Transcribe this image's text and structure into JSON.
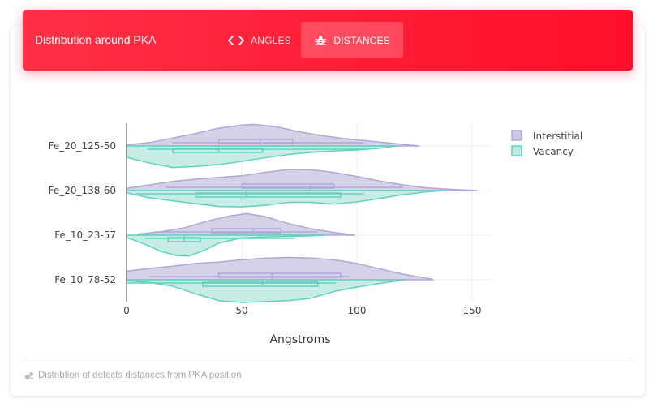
{
  "header": {
    "title": "Distribution around PKA",
    "tabs": [
      {
        "label": "ANGLES",
        "icon": "code-icon",
        "active": false
      },
      {
        "label": "DISTANCES",
        "icon": "bug-icon",
        "active": true
      }
    ],
    "accent": "#ff1a35"
  },
  "chart_data": {
    "type": "violin",
    "orientation": "horizontal",
    "categories": [
      "Fe_10_78-52",
      "Fe_10_23-57",
      "Fe_20_138-60",
      "Fe_20_125-50"
    ],
    "xlabel": "Angstroms",
    "xlim": [
      0,
      160
    ],
    "xticks": [
      0,
      50,
      100,
      150
    ],
    "grid": true,
    "legend": "top-right",
    "series": [
      {
        "name": "Interstitial",
        "side": "positive",
        "fill": "#cfc8e4",
        "stroke": "#b1a7d7",
        "violins": [
          {
            "category": "Fe_10_78-52",
            "min": 0,
            "max": 133,
            "q1": 40,
            "median": 63,
            "q3": 93,
            "whisker_low": 10,
            "whisker_high": 97,
            "density": [
              [
                0,
                0.38
              ],
              [
                10,
                0.5
              ],
              [
                20,
                0.6
              ],
              [
                30,
                0.72
              ],
              [
                40,
                0.78
              ],
              [
                50,
                0.88
              ],
              [
                60,
                0.95
              ],
              [
                70,
                0.98
              ],
              [
                80,
                0.96
              ],
              [
                90,
                0.88
              ],
              [
                100,
                0.72
              ],
              [
                110,
                0.48
              ],
              [
                120,
                0.25
              ],
              [
                133,
                0.02
              ]
            ]
          },
          {
            "category": "Fe_10_23-57",
            "min": 5,
            "max": 99,
            "q1": 37,
            "median": 55,
            "q3": 67,
            "whisker_low": 12,
            "whisker_high": 83,
            "density": [
              [
                5,
                0.05
              ],
              [
                15,
                0.15
              ],
              [
                25,
                0.32
              ],
              [
                35,
                0.62
              ],
              [
                45,
                0.85
              ],
              [
                52,
                0.95
              ],
              [
                60,
                0.82
              ],
              [
                70,
                0.52
              ],
              [
                80,
                0.28
              ],
              [
                90,
                0.12
              ],
              [
                99,
                0.0
              ]
            ]
          },
          {
            "category": "Fe_20_138-60",
            "min": 0,
            "max": 152,
            "q1": 50,
            "median": 80,
            "q3": 90,
            "whisker_low": 17,
            "whisker_high": 120,
            "density": [
              [
                0,
                0.1
              ],
              [
                10,
                0.25
              ],
              [
                20,
                0.4
              ],
              [
                30,
                0.5
              ],
              [
                40,
                0.58
              ],
              [
                50,
                0.65
              ],
              [
                60,
                0.8
              ],
              [
                70,
                0.93
              ],
              [
                80,
                0.92
              ],
              [
                90,
                0.8
              ],
              [
                100,
                0.62
              ],
              [
                110,
                0.42
              ],
              [
                120,
                0.25
              ],
              [
                130,
                0.12
              ],
              [
                140,
                0.06
              ],
              [
                152,
                0.0
              ]
            ]
          },
          {
            "category": "Fe_20_125-50",
            "min": 0,
            "max": 127,
            "q1": 40,
            "median": 58,
            "q3": 72,
            "whisker_low": 20,
            "whisker_high": 103,
            "density": [
              [
                0,
                0.05
              ],
              [
                10,
                0.15
              ],
              [
                20,
                0.35
              ],
              [
                30,
                0.55
              ],
              [
                40,
                0.78
              ],
              [
                50,
                0.92
              ],
              [
                55,
                0.95
              ],
              [
                65,
                0.85
              ],
              [
                75,
                0.62
              ],
              [
                85,
                0.45
              ],
              [
                95,
                0.32
              ],
              [
                105,
                0.22
              ],
              [
                115,
                0.12
              ],
              [
                127,
                0.0
              ]
            ]
          }
        ]
      },
      {
        "name": "Vacancy",
        "side": "negative",
        "fill": "#bde9e2",
        "stroke": "#5fd3bd",
        "violins": [
          {
            "category": "Fe_10_78-52",
            "min": 0,
            "max": 121,
            "q1": 33,
            "median": 59,
            "q3": 83,
            "whisker_low": 0,
            "whisker_high": 91,
            "density": [
              [
                0,
                0.05
              ],
              [
                10,
                0.12
              ],
              [
                20,
                0.28
              ],
              [
                30,
                0.62
              ],
              [
                40,
                0.92
              ],
              [
                50,
                1.0
              ],
              [
                60,
                0.96
              ],
              [
                70,
                0.92
              ],
              [
                80,
                0.82
              ],
              [
                90,
                0.52
              ],
              [
                100,
                0.32
              ],
              [
                110,
                0.16
              ],
              [
                121,
                0.0
              ]
            ]
          },
          {
            "category": "Fe_10_23-57",
            "min": 0,
            "max": 86,
            "q1": 18,
            "median": 25,
            "q3": 32,
            "whisker_low": 8,
            "whisker_high": 73,
            "density": [
              [
                0,
                0.1
              ],
              [
                8,
                0.4
              ],
              [
                15,
                0.72
              ],
              [
                22,
                0.9
              ],
              [
                27,
                0.92
              ],
              [
                33,
                0.7
              ],
              [
                40,
                0.35
              ],
              [
                50,
                0.12
              ],
              [
                60,
                0.08
              ],
              [
                70,
                0.06
              ],
              [
                80,
                0.03
              ],
              [
                86,
                0.0
              ]
            ]
          },
          {
            "category": "Fe_20_138-60",
            "min": 0,
            "max": 138,
            "q1": 30,
            "median": 52,
            "q3": 93,
            "whisker_low": 4,
            "whisker_high": 103,
            "density": [
              [
                0,
                0.1
              ],
              [
                10,
                0.32
              ],
              [
                20,
                0.45
              ],
              [
                30,
                0.58
              ],
              [
                40,
                0.7
              ],
              [
                50,
                0.72
              ],
              [
                60,
                0.65
              ],
              [
                70,
                0.52
              ],
              [
                80,
                0.52
              ],
              [
                90,
                0.6
              ],
              [
                100,
                0.5
              ],
              [
                110,
                0.35
              ],
              [
                120,
                0.18
              ],
              [
                130,
                0.06
              ],
              [
                138,
                0.0
              ]
            ]
          },
          {
            "category": "Fe_20_125-50",
            "min": 0,
            "max": 117,
            "q1": 20,
            "median": 40,
            "q3": 59,
            "whisker_low": 9,
            "whisker_high": 103,
            "density": [
              [
                0,
                0.5
              ],
              [
                10,
                0.75
              ],
              [
                20,
                0.95
              ],
              [
                30,
                0.9
              ],
              [
                40,
                0.82
              ],
              [
                50,
                0.68
              ],
              [
                60,
                0.52
              ],
              [
                70,
                0.38
              ],
              [
                80,
                0.28
              ],
              [
                90,
                0.22
              ],
              [
                100,
                0.18
              ],
              [
                110,
                0.1
              ],
              [
                117,
                0.0
              ]
            ]
          }
        ]
      }
    ]
  },
  "footer": {
    "icon": "bubbles-icon",
    "text": "Distribtion of defects distances from PKA position"
  }
}
